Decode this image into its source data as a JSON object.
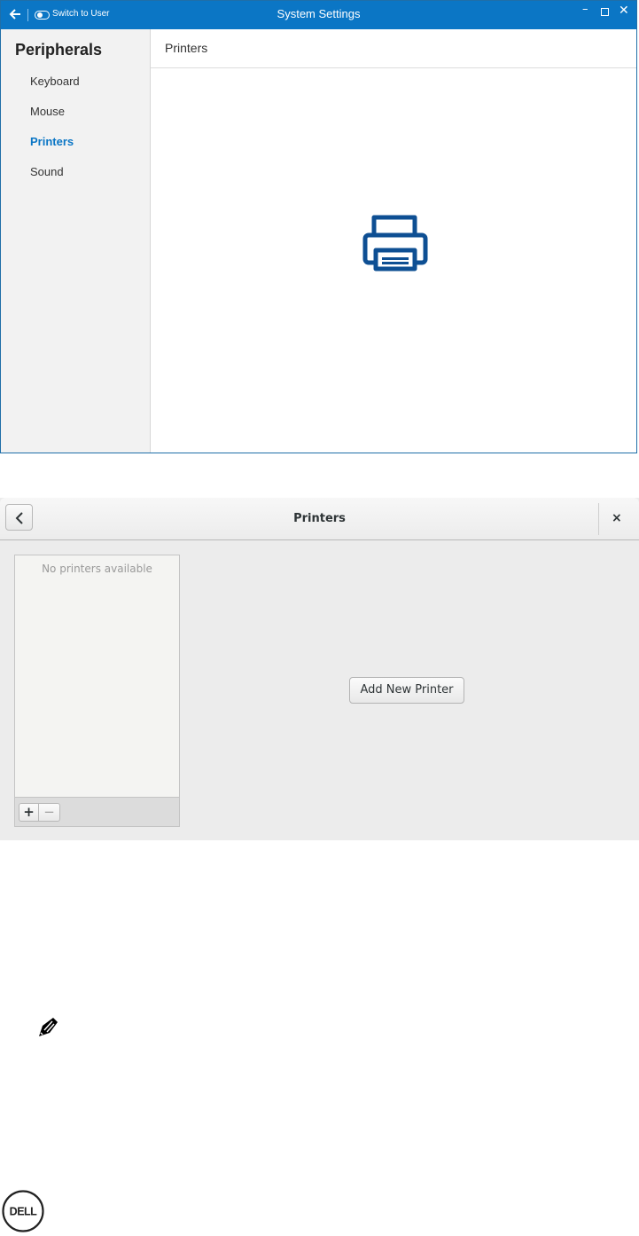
{
  "settings_window": {
    "back_icon": "arrow-left-icon",
    "switch_label": "Switch to User",
    "title": "System Settings",
    "controls": {
      "minimize": "–",
      "close": "✕"
    },
    "sidebar": {
      "heading": "Peripherals",
      "items": [
        {
          "label": "Keyboard",
          "active": false
        },
        {
          "label": "Mouse",
          "active": false
        },
        {
          "label": "Printers",
          "active": true
        },
        {
          "label": "Sound",
          "active": false
        }
      ]
    },
    "content": {
      "header": "Printers",
      "icon": "printer-icon"
    },
    "colors": {
      "accent": "#0b76c5",
      "icon": "#0e4f93"
    }
  },
  "printers_dialog": {
    "title": "Printers",
    "back_icon": "chevron-left-icon",
    "close_label": "×",
    "list": {
      "empty_text": "No printers available"
    },
    "toolbar": {
      "add_label": "+",
      "remove_label": "−"
    },
    "add_button_label": "Add New Printer"
  },
  "page": {
    "note_icon": "note-pencil-icon",
    "logo": "dell-logo"
  }
}
